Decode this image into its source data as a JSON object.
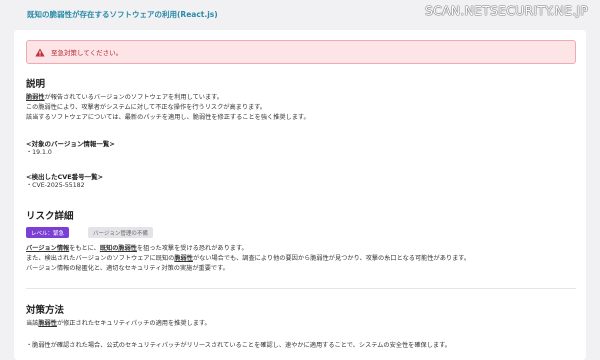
{
  "header": {
    "title": "既知の脆弱性が存在するソフトウェアの利用(React.js)",
    "watermark": "SCAN.NETSECURITY.NE.JP"
  },
  "alert": {
    "icon": "warning-icon",
    "text": "至急対策してください。",
    "color": "#b3262f"
  },
  "description": {
    "heading": "説明",
    "line1_strong": "脆弱性",
    "line1_rest": "が報告されているバージョンのソフトウェアを利用しています。",
    "line2": "この脆弱性により、攻撃者がシステムに対して不正な操作を行うリスクが高まります。",
    "line3": "該当するソフトウェアについては、最新のパッチを適用し、脆弱性を修正することを強く推奨します。",
    "versions_heading": "<対象のバージョン情報一覧>",
    "version_item": "・19.1.0",
    "cve_heading": "<検出したCVE番号一覧>",
    "cve_item": "・CVE-2025-55182"
  },
  "risk": {
    "heading": "リスク詳細",
    "level_badge": "レベル：緊急",
    "tag_badge": "バージョン管理の不備",
    "line1_a": "バージョン情報",
    "line1_b": "をもとに、",
    "line1_c": "既知の脆弱性",
    "line1_d": "を狙った攻撃を受ける恐れがあります。",
    "line2_a": "また、検出されたバージョンのソフトウェアに既知の",
    "line2_b": "脆弱性",
    "line2_c": "がない場合でも、調査により他の要因から脆弱性が見つかり、攻撃の糸口となる可能性があります。",
    "line3": "バージョン情報の秘匿化と、適切なセキュリティ対策の実施が重要です。"
  },
  "countermeasure": {
    "heading": "対策方法",
    "line1_a": "当該",
    "line1_b": "脆弱性",
    "line1_c": "が修正されたセキュリティパッチの適用を推奨します。",
    "line2": "・脆弱性が確認された場合、公式のセキュリティパッチがリリースされていることを確認し、速やかに適用することで、システムの安全性を確保します。"
  },
  "colors": {
    "title": "#2a8aa8",
    "badge_level": "#7b3fd4",
    "alert_bg": "#fde4e6"
  }
}
